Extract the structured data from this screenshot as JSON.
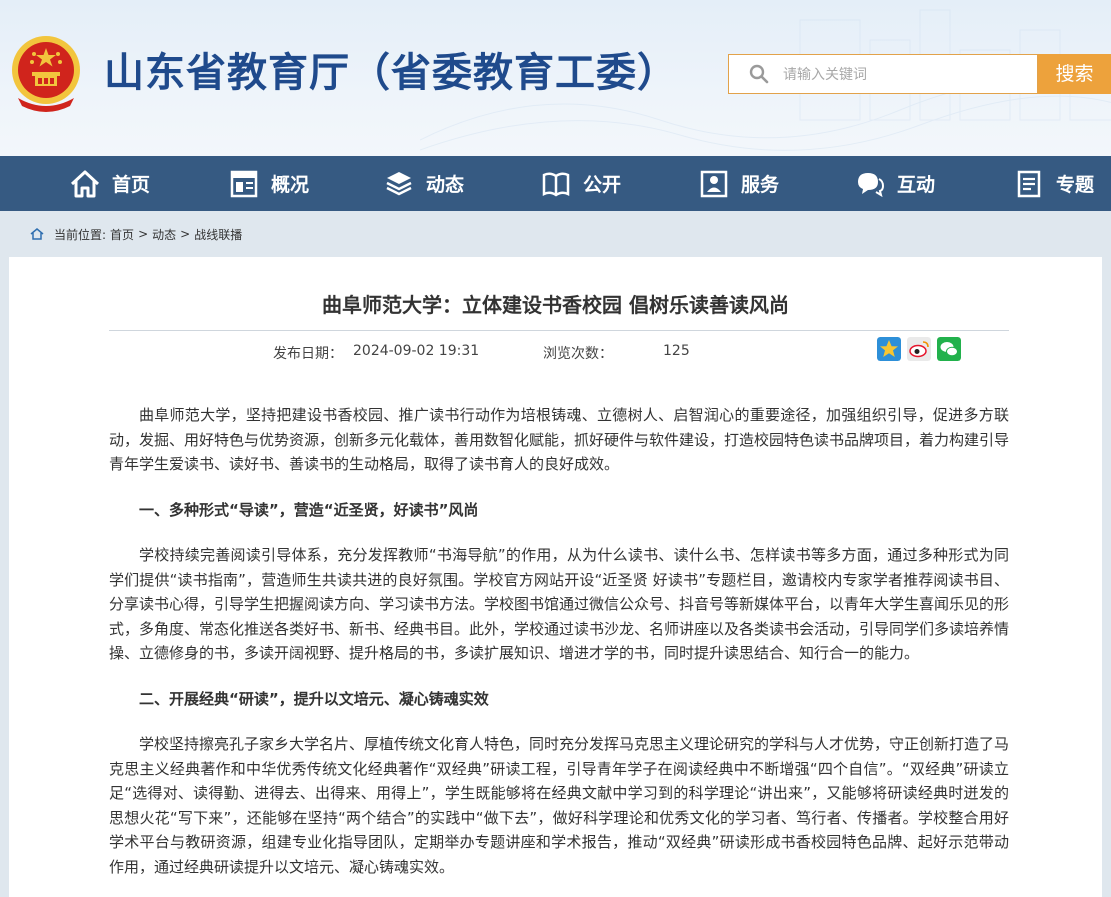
{
  "header": {
    "site_title": "山东省教育厅（省委教育工委）",
    "search_placeholder": "请输入关键词",
    "search_button": "搜索"
  },
  "nav": {
    "items": [
      {
        "label": "首页",
        "icon": "home-icon"
      },
      {
        "label": "概况",
        "icon": "overview-icon"
      },
      {
        "label": "动态",
        "icon": "news-icon"
      },
      {
        "label": "公开",
        "icon": "book-icon"
      },
      {
        "label": "服务",
        "icon": "service-icon"
      },
      {
        "label": "互动",
        "icon": "chat-icon"
      },
      {
        "label": "专题",
        "icon": "document-icon"
      }
    ]
  },
  "breadcrumb": {
    "prefix": "当前位置:",
    "items": [
      "首页",
      "动态",
      "战线联播"
    ],
    "separator": ">"
  },
  "article": {
    "title": "曲阜师范大学：立体建设书香校园 倡树乐读善读风尚",
    "publish_label": "发布日期：",
    "publish_date": "2024-09-02 19:31",
    "views_label": "浏览次数：",
    "views": "125",
    "share_icons": [
      "qzone-icon",
      "weibo-icon",
      "wechat-icon"
    ],
    "blocks": [
      {
        "type": "p",
        "text": "曲阜师范大学，坚持把建设书香校园、推广读书行动作为培根铸魂、立德树人、启智润心的重要途径，加强组织引导，促进多方联动，发掘、用好特色与优势资源，创新多元化载体，善用数智化赋能，抓好硬件与软件建设，打造校园特色读书品牌项目，着力构建引导青年学生爱读书、读好书、善读书的生动格局，取得了读书育人的良好成效。"
      },
      {
        "type": "h",
        "text": "一、多种形式“导读”，营造“近圣贤，好读书”风尚"
      },
      {
        "type": "p",
        "text": "学校持续完善阅读引导体系，充分发挥教师“书海导航”的作用，从为什么读书、读什么书、怎样读书等多方面，通过多种形式为同学们提供“读书指南”，营造师生共读共进的良好氛围。学校官方网站开设“近圣贤 好读书”专题栏目，邀请校内专家学者推荐阅读书目、分享读书心得，引导学生把握阅读方向、学习读书方法。学校图书馆通过微信公众号、抖音号等新媒体平台，以青年大学生喜闻乐见的形式，多角度、常态化推送各类好书、新书、经典书目。此外，学校通过读书沙龙、名师讲座以及各类读书会活动，引导同学们多读培养情操、立德修身的书，多读开阔视野、提升格局的书，多读扩展知识、增进才学的书，同时提升读思结合、知行合一的能力。"
      },
      {
        "type": "h",
        "text": "二、开展经典“研读”，提升以文培元、凝心铸魂实效"
      },
      {
        "type": "p",
        "text": "学校坚持擦亮孔子家乡大学名片、厚植传统文化育人特色，同时充分发挥马克思主义理论研究的学科与人才优势，守正创新打造了马克思主义经典著作和中华优秀传统文化经典著作“双经典”研读工程，引导青年学子在阅读经典中不断增强“四个自信”。“双经典”研读立足“选得对、读得勤、进得去、出得来、用得上”，学生既能够将在经典文献中学习到的科学理论“讲出来”，又能够将研读经典时迸发的思想火花“写下来”，还能够在坚持“两个结合”的实践中“做下去”，做好科学理论和优秀文化的学习者、笃行者、传播者。学校整合用好学术平台与教研资源，组建专业化指导团队，定期举办专题讲座和学术报告，推动“双经典”研读形成书香校园特色品牌、起好示范带动作用，通过经典研读提升以文培元、凝心铸魂实效。"
      }
    ]
  },
  "colors": {
    "nav_bg": "#365a82",
    "title_blue": "#1f4a8c",
    "search_orange": "#eda23c",
    "emblem_red": "#d0241c",
    "emblem_gold": "#f2c53d"
  }
}
